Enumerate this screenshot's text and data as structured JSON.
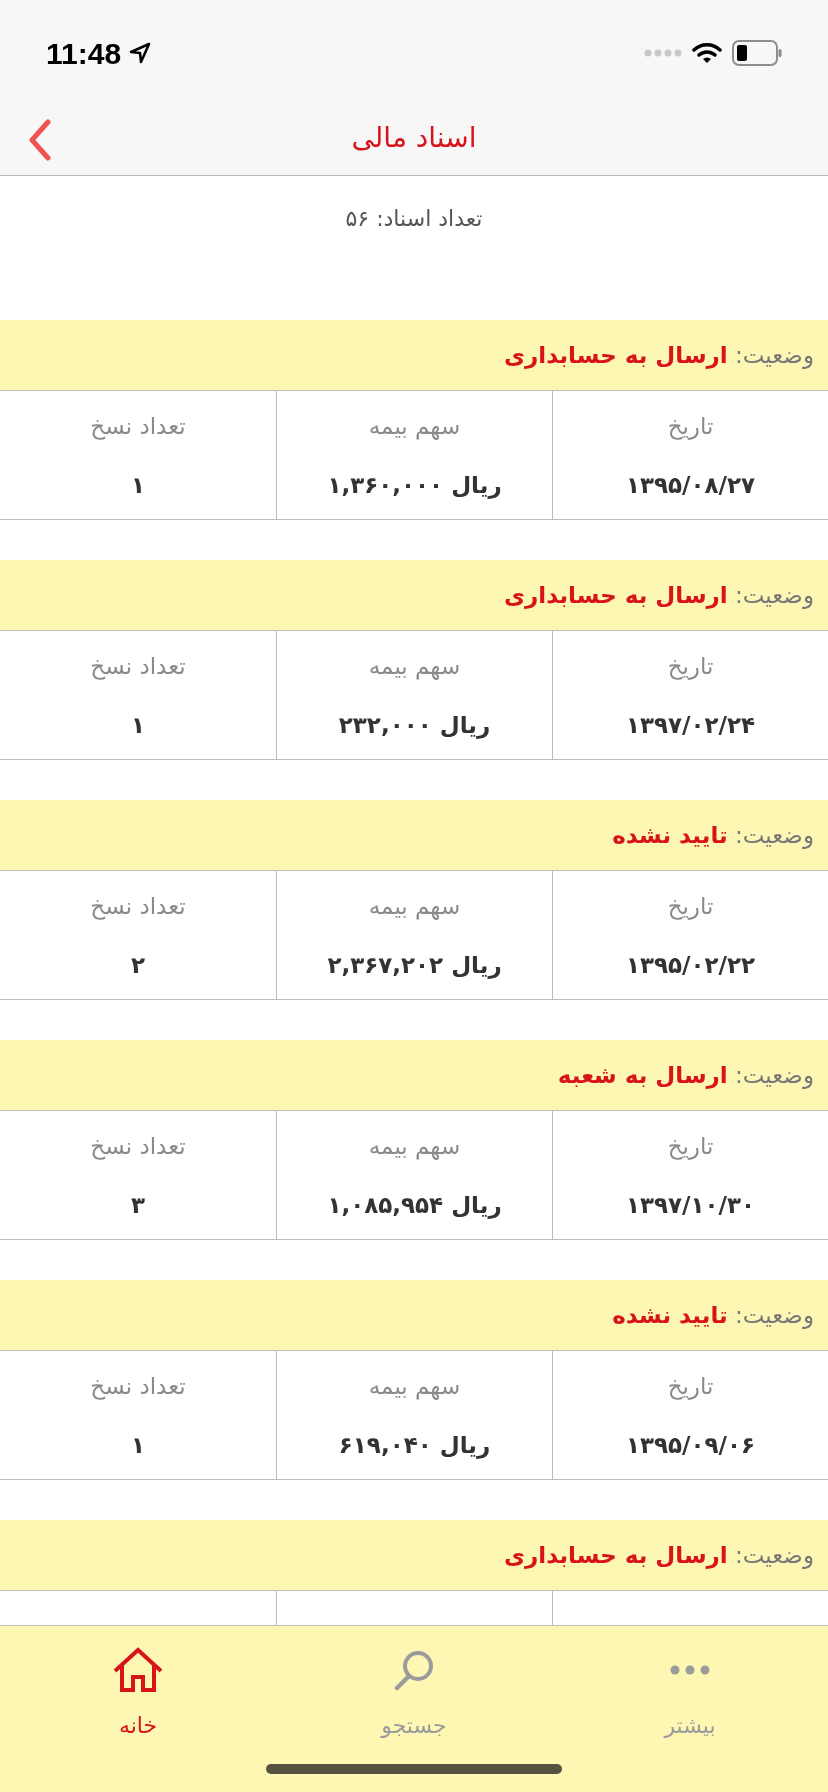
{
  "status_bar": {
    "time": "11:48"
  },
  "nav": {
    "title": "اسناد مالی"
  },
  "summary": "تعداد اسناد: ۵۶",
  "documents": [
    {
      "status_label": "وضعیت:",
      "status": "ارسال به حسابداری",
      "cells": [
        {
          "label": "تاریخ",
          "value": "۱۳۹۵/۰۸/۲۷"
        },
        {
          "label": "سهم بیمه",
          "value": "ریال ۱,۳۶۰,۰۰۰"
        },
        {
          "label": "تعداد نسخ",
          "value": "۱"
        }
      ]
    },
    {
      "status_label": "وضعیت:",
      "status": "ارسال به حسابداری",
      "cells": [
        {
          "label": "تاریخ",
          "value": "۱۳۹۷/۰۲/۲۴"
        },
        {
          "label": "سهم بیمه",
          "value": "ریال ۲۳۲,۰۰۰"
        },
        {
          "label": "تعداد نسخ",
          "value": "۱"
        }
      ]
    },
    {
      "status_label": "وضعیت:",
      "status": "تایید نشده",
      "cells": [
        {
          "label": "تاریخ",
          "value": "۱۳۹۵/۰۲/۲۲"
        },
        {
          "label": "سهم بیمه",
          "value": "ریال ۲,۳۶۷,۲۰۲"
        },
        {
          "label": "تعداد نسخ",
          "value": "۲"
        }
      ]
    },
    {
      "status_label": "وضعیت:",
      "status": "ارسال به شعبه",
      "cells": [
        {
          "label": "تاریخ",
          "value": "۱۳۹۷/۱۰/۳۰"
        },
        {
          "label": "سهم بیمه",
          "value": "ریال ۱,۰۸۵,۹۵۴"
        },
        {
          "label": "تعداد نسخ",
          "value": "۳"
        }
      ]
    },
    {
      "status_label": "وضعیت:",
      "status": "تایید نشده",
      "cells": [
        {
          "label": "تاریخ",
          "value": "۱۳۹۵/۰۹/۰۶"
        },
        {
          "label": "سهم بیمه",
          "value": "ریال ۶۱۹,۰۴۰"
        },
        {
          "label": "تعداد نسخ",
          "value": "۱"
        }
      ]
    },
    {
      "status_label": "وضعیت:",
      "status": "ارسال به حسابداری"
    }
  ],
  "tab_bar": [
    {
      "kind": "more",
      "label": "بیشتر",
      "selected": false
    },
    {
      "kind": "search",
      "label": "جستجو",
      "selected": false
    },
    {
      "kind": "home",
      "label": "خانه",
      "selected": true
    }
  ]
}
